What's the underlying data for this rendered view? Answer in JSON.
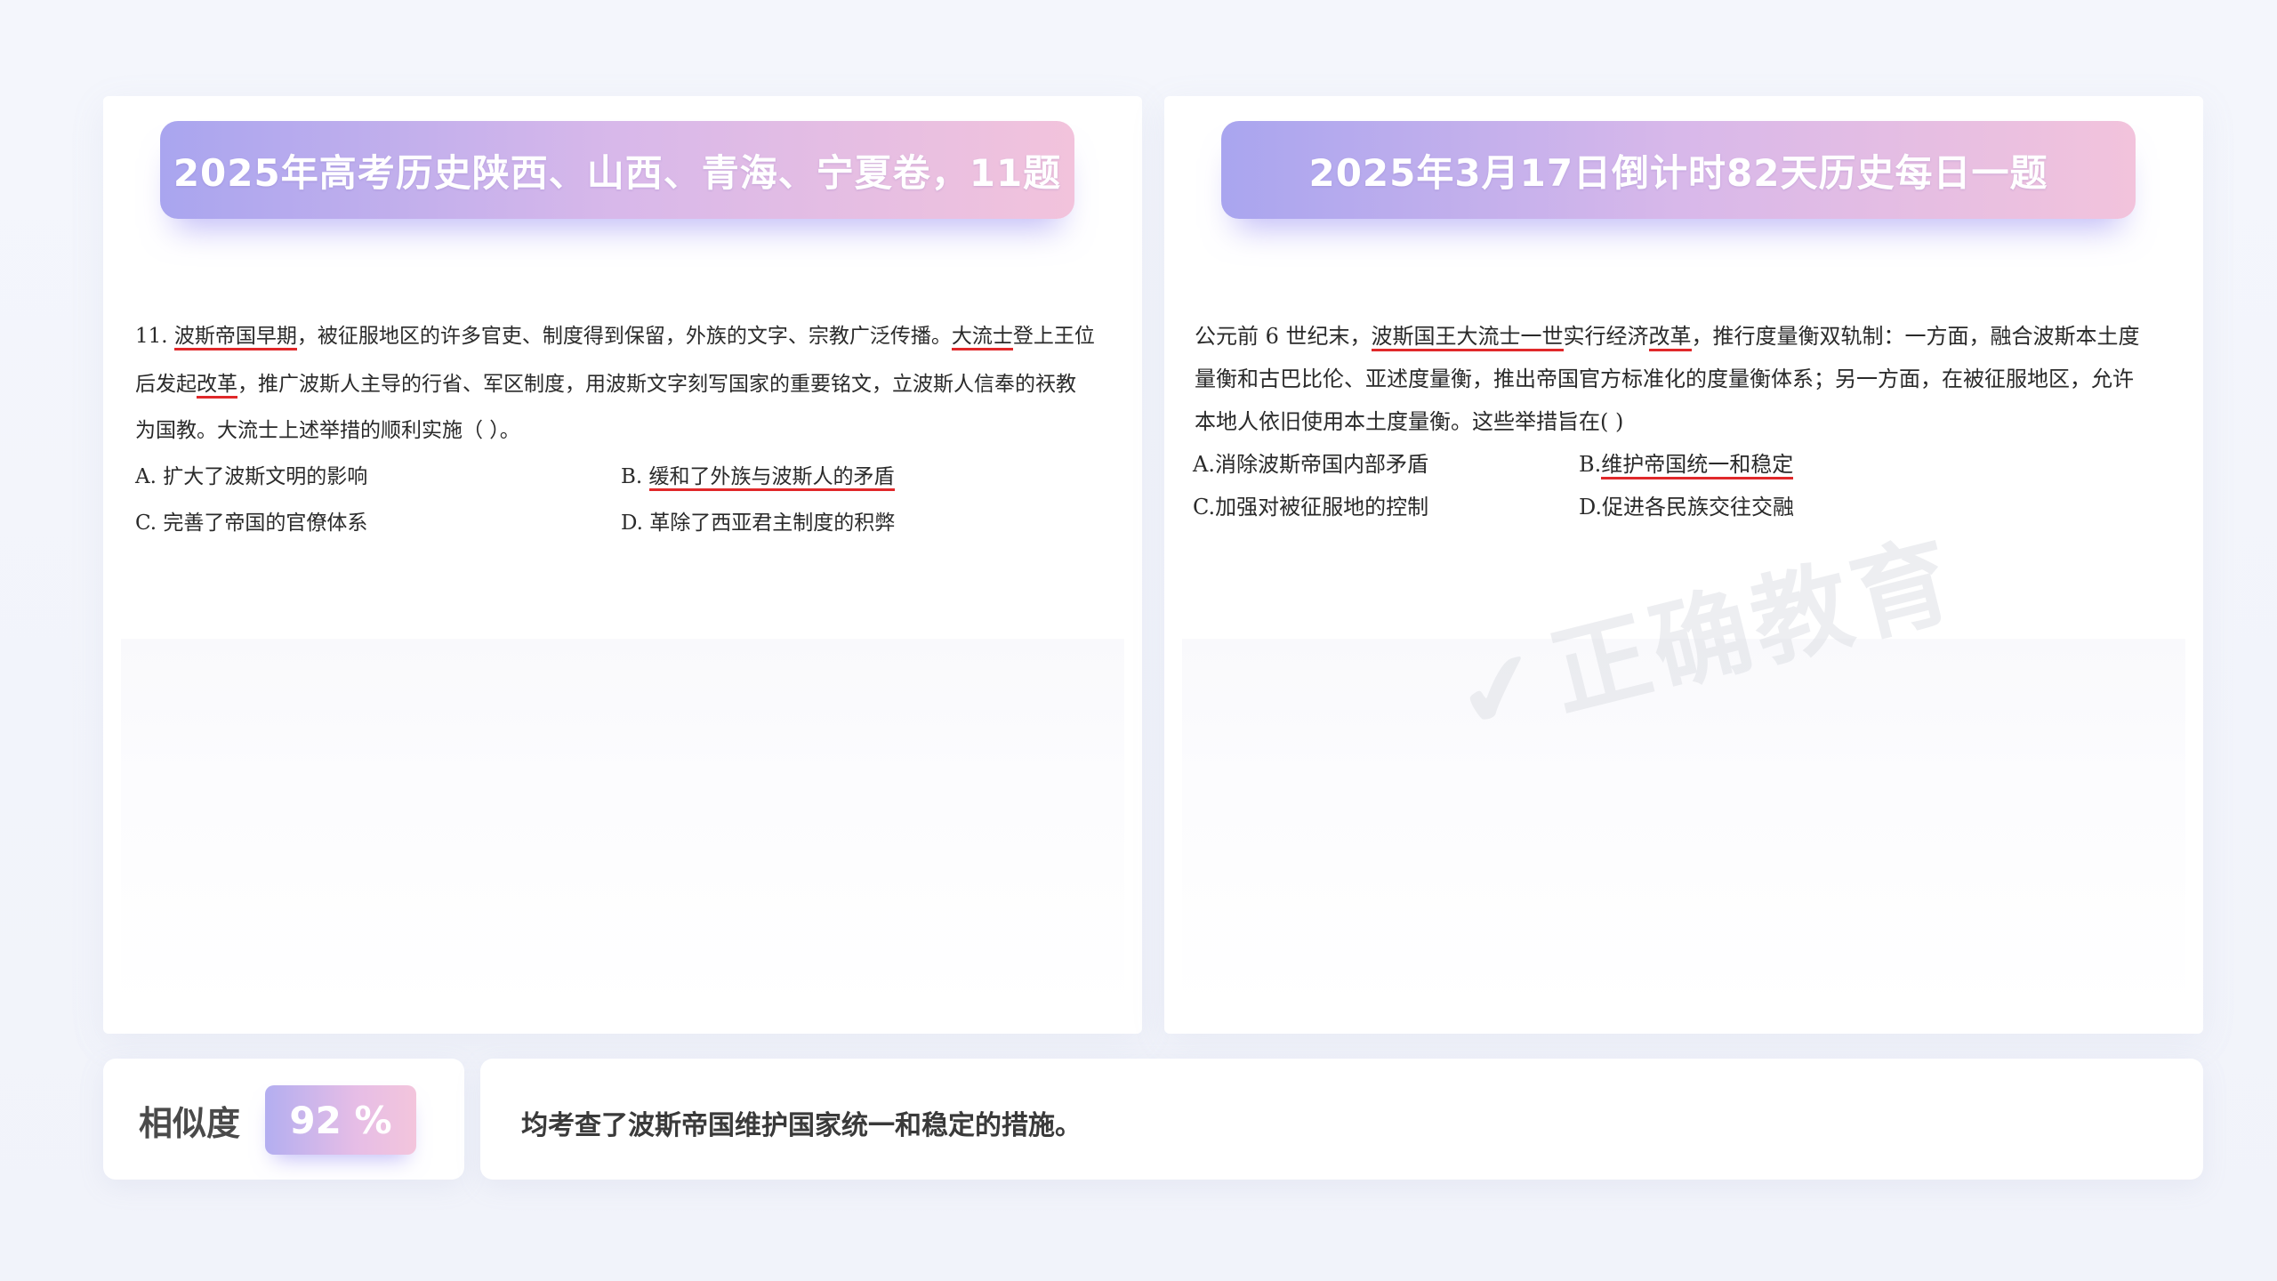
{
  "left": {
    "title": "2025年高考历史陕西、山西、青海、宁夏卷，11题",
    "question": {
      "line1": {
        "a": "11. ",
        "b": "波斯帝国早期",
        "c": "，被征服地区的许多官吏、制度得到保留，外族的文字、宗教广泛传播。",
        "d": "大流士",
        "e": "登上王位"
      },
      "line2": {
        "a": "后发起",
        "b": "改革",
        "c": "，推广波斯人主导的行省、军区制度，用波斯文字刻写国家的重要铭文，立波斯人信奉的祆教"
      },
      "line3": "为国教。大流士上述举措的顺利实施（      ）。",
      "options": {
        "a": "A.  扩大了波斯文明的影响",
        "b_prefix": "B.  ",
        "b_text": "缓和了外族与波斯人的矛盾",
        "c": "C.  完善了帝国的官僚体系",
        "d": "D.  革除了西亚君主制度的积弊"
      }
    }
  },
  "right": {
    "title": "2025年3月17日倒计时82天历史每日一题",
    "question": {
      "line1": {
        "a": "公元前 6 世纪末，",
        "b": "波斯国王大流士一世",
        "c": "实行经济",
        "d": "改革",
        "e": "，推行度量衡双轨制：一方面，融合波斯本土度"
      },
      "line2": "量衡和古巴比伦、亚述度量衡，推出帝国官方标准化的度量衡体系；另一方面，在被征服地区，允许",
      "line3": "本地人依旧使用本土度量衡。这些举措旨在(      )",
      "options": {
        "a": "A.消除波斯帝国内部矛盾",
        "b_prefix": "B.",
        "b_text": "维护帝国统一和稳定",
        "c": "C.加强对被征服地的控制",
        "d": "D.促进各民族交往交融"
      }
    },
    "watermark": "正确教育"
  },
  "similarity": {
    "label": "相似度",
    "value": "92 %"
  },
  "description": "均考查了波斯帝国维护国家统一和稳定的措施。"
}
